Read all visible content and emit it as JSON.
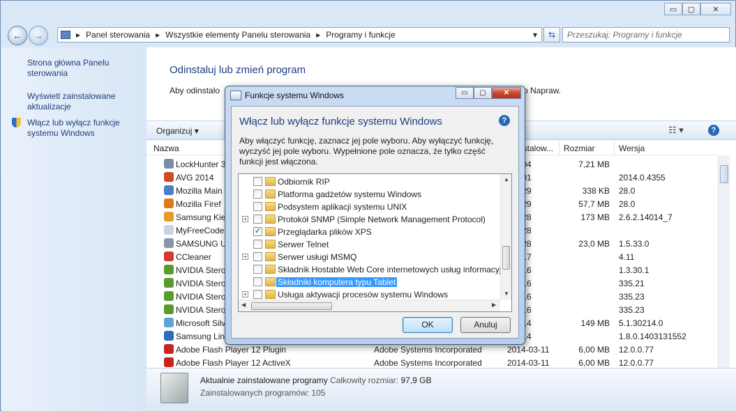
{
  "window": {
    "minimize": "▭",
    "maximize": "▢",
    "close": "✕"
  },
  "nav": {
    "back_icon": "←",
    "forward_icon": "→",
    "refresh_icon": "⇆",
    "breadcrumb": [
      "Panel sterowania",
      "Wszystkie elementy Panelu sterowania",
      "Programy i funkcje"
    ],
    "search_placeholder": "Przeszukaj: Programy i funkcje"
  },
  "sidebar": {
    "links": [
      "Strona główna Panelu sterowania",
      "Wyświetl zainstalowane aktualizacje",
      "Włącz lub wyłącz funkcje systemu Windows"
    ]
  },
  "main": {
    "title": "Odinstaluj lub zmień program",
    "desc_left": "Aby odinstalo",
    "desc_right": "b Napraw.",
    "organize": "Organizuj ▾",
    "columns": {
      "name": "Nazwa",
      "installed": "nstalow...",
      "size": "Rozmiar",
      "version": "Wersja"
    },
    "rows": [
      {
        "name": "LockHunter 3",
        "publisher": "",
        "date": "-04-04",
        "size": "7,21 MB",
        "version": "",
        "color": "#7a8ca7"
      },
      {
        "name": "AVG 2014",
        "publisher": "",
        "date": "-04-01",
        "size": "",
        "version": "2014.0.4355",
        "color": "#d04a28"
      },
      {
        "name": "Mozilla Main",
        "publisher": "",
        "date": "-03-29",
        "size": "338 KB",
        "version": "28.0",
        "color": "#4b7ec4"
      },
      {
        "name": "Mozilla Firef",
        "publisher": "",
        "date": "-03-29",
        "size": "57,7 MB",
        "version": "28.0",
        "color": "#e2771a"
      },
      {
        "name": "Samsung Kie",
        "publisher": "",
        "date": "-03-28",
        "size": "173 MB",
        "version": "2.6.2.14014_7",
        "color": "#e89a22"
      },
      {
        "name": "MyFreeCode",
        "publisher": "",
        "date": "-03-28",
        "size": "",
        "version": "",
        "color": "#c8d3e2"
      },
      {
        "name": "SAMSUNG U",
        "publisher": "",
        "date": "-03-28",
        "size": "23,0 MB",
        "version": "1.5.33.0",
        "color": "#8b95a6"
      },
      {
        "name": "CCleaner",
        "publisher": "",
        "date": "-03-17",
        "size": "",
        "version": "4.11",
        "color": "#d33b2f"
      },
      {
        "name": "NVIDIA Stero",
        "publisher": "",
        "date": "-03-16",
        "size": "",
        "version": "1.3.30.1",
        "color": "#5b9b2d"
      },
      {
        "name": "NVIDIA Stero",
        "publisher": "",
        "date": "-03-16",
        "size": "",
        "version": "335.21",
        "color": "#5b9b2d"
      },
      {
        "name": "NVIDIA Stero",
        "publisher": "",
        "date": "-03-16",
        "size": "",
        "version": "335.23",
        "color": "#5b9b2d"
      },
      {
        "name": "NVIDIA Stero",
        "publisher": "",
        "date": "-03-16",
        "size": "",
        "version": "335.23",
        "color": "#5b9b2d"
      },
      {
        "name": "Microsoft Silv",
        "publisher": "",
        "date": "-03-14",
        "size": "149 MB",
        "version": "5.1.30214.0",
        "color": "#5fa2dd"
      },
      {
        "name": "Samsung Lin",
        "publisher": "",
        "date": "-03-14",
        "size": "",
        "version": "1.8.0.1403131552",
        "color": "#2c6bbd"
      },
      {
        "name": "Adobe Flash Player 12 Plugin",
        "publisher": "Adobe Systems Incorporated",
        "date": "2014-03-11",
        "size": "6,00 MB",
        "version": "12.0.0.77",
        "color": "#c8231e"
      },
      {
        "name": "Adobe Flash Player 12 ActiveX",
        "publisher": "Adobe Systems Incorporated",
        "date": "2014-03-11",
        "size": "6,00 MB",
        "version": "12.0.0.77",
        "color": "#c8231e"
      }
    ]
  },
  "footer": {
    "line1": "Aktualnie zainstalowane programy",
    "size_label": "Całkowity rozmiar:",
    "size_value": "97,9 GB",
    "line2": "Zainstalowanych programów: 105"
  },
  "dialog": {
    "title": "Funkcje systemu Windows",
    "heading": "Włącz lub wyłącz funkcje systemu Windows",
    "instructions": "Aby włączyć funkcję, zaznacz jej pole wyboru. Aby wyłączyć funkcję, wyczyść jej pole wyboru. Wypełnione pole oznacza, że tylko część funkcji jest włączona.",
    "help": "?",
    "items": [
      {
        "label": "Odbiornik RIP",
        "expandable": false,
        "checked": false,
        "selected": false
      },
      {
        "label": "Platforma gadżetów systemu Windows",
        "expandable": false,
        "checked": false,
        "selected": false
      },
      {
        "label": "Podsystem aplikacji systemu UNIX",
        "expandable": false,
        "checked": false,
        "selected": false
      },
      {
        "label": "Protokół SNMP (Simple Network Management Protocol)",
        "expandable": true,
        "checked": false,
        "selected": false
      },
      {
        "label": "Przeglądarka plików XPS",
        "expandable": false,
        "checked": true,
        "selected": false
      },
      {
        "label": "Serwer Telnet",
        "expandable": false,
        "checked": false,
        "selected": false
      },
      {
        "label": "Serwer usługi MSMQ",
        "expandable": true,
        "checked": false,
        "selected": false
      },
      {
        "label": "Składnik Hostable Web Core internetowych usług informacyj",
        "expandable": false,
        "checked": false,
        "selected": false
      },
      {
        "label": "Składniki komputera typu Tablet",
        "expandable": false,
        "checked": false,
        "selected": true
      },
      {
        "label": "Usługa aktywacji procesów systemu Windows",
        "expandable": true,
        "checked": false,
        "selected": false
      }
    ],
    "ok": "OK",
    "cancel": "Anuluj"
  }
}
